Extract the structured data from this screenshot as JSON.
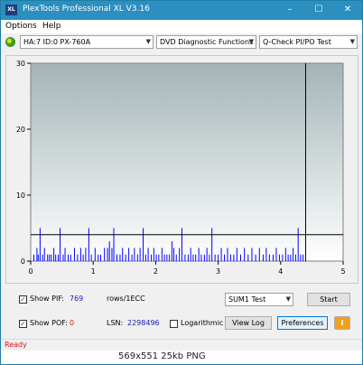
{
  "window": {
    "title": "PlexTools Professional XL V3.16",
    "icon_label": "XL",
    "minimize": "–",
    "maximize": "☐",
    "close": "✕"
  },
  "menu": {
    "options": "Options",
    "help": "Help"
  },
  "toolbar": {
    "device": "HA:7 ID:0  PX-760A",
    "function": "DVD Diagnostic Functions",
    "test": "Q-Check PI/PO Test"
  },
  "chart_data": {
    "type": "bar",
    "xlim": [
      0,
      5
    ],
    "ylim": [
      0,
      30
    ],
    "x_ticks": [
      0,
      1,
      2,
      3,
      4,
      5
    ],
    "y_ticks": [
      0,
      10,
      20,
      30
    ],
    "threshold": 4,
    "end_marker": 4.4,
    "bar_color": "#0000ff",
    "bars": [
      {
        "x": 0.05,
        "y": 1
      },
      {
        "x": 0.1,
        "y": 2
      },
      {
        "x": 0.12,
        "y": 1
      },
      {
        "x": 0.15,
        "y": 5
      },
      {
        "x": 0.19,
        "y": 1
      },
      {
        "x": 0.22,
        "y": 2
      },
      {
        "x": 0.27,
        "y": 1
      },
      {
        "x": 0.3,
        "y": 1
      },
      {
        "x": 0.33,
        "y": 1
      },
      {
        "x": 0.37,
        "y": 2
      },
      {
        "x": 0.4,
        "y": 1
      },
      {
        "x": 0.44,
        "y": 1
      },
      {
        "x": 0.47,
        "y": 5
      },
      {
        "x": 0.52,
        "y": 1
      },
      {
        "x": 0.55,
        "y": 2
      },
      {
        "x": 0.6,
        "y": 1
      },
      {
        "x": 0.64,
        "y": 1
      },
      {
        "x": 0.7,
        "y": 2
      },
      {
        "x": 0.75,
        "y": 1
      },
      {
        "x": 0.8,
        "y": 2
      },
      {
        "x": 0.84,
        "y": 1
      },
      {
        "x": 0.88,
        "y": 2
      },
      {
        "x": 0.93,
        "y": 5
      },
      {
        "x": 0.97,
        "y": 1
      },
      {
        "x": 1.03,
        "y": 2
      },
      {
        "x": 1.08,
        "y": 1
      },
      {
        "x": 1.12,
        "y": 1
      },
      {
        "x": 1.18,
        "y": 2
      },
      {
        "x": 1.23,
        "y": 2
      },
      {
        "x": 1.26,
        "y": 3
      },
      {
        "x": 1.3,
        "y": 2
      },
      {
        "x": 1.33,
        "y": 5
      },
      {
        "x": 1.38,
        "y": 1
      },
      {
        "x": 1.43,
        "y": 1
      },
      {
        "x": 1.47,
        "y": 2
      },
      {
        "x": 1.52,
        "y": 1
      },
      {
        "x": 1.57,
        "y": 2
      },
      {
        "x": 1.62,
        "y": 1
      },
      {
        "x": 1.66,
        "y": 2
      },
      {
        "x": 1.71,
        "y": 1
      },
      {
        "x": 1.75,
        "y": 2
      },
      {
        "x": 1.8,
        "y": 5
      },
      {
        "x": 1.84,
        "y": 1
      },
      {
        "x": 1.88,
        "y": 2
      },
      {
        "x": 1.93,
        "y": 1
      },
      {
        "x": 1.97,
        "y": 2
      },
      {
        "x": 2.01,
        "y": 1
      },
      {
        "x": 2.05,
        "y": 1
      },
      {
        "x": 2.1,
        "y": 2
      },
      {
        "x": 2.14,
        "y": 1
      },
      {
        "x": 2.18,
        "y": 1
      },
      {
        "x": 2.22,
        "y": 1
      },
      {
        "x": 2.26,
        "y": 3
      },
      {
        "x": 2.29,
        "y": 2
      },
      {
        "x": 2.33,
        "y": 1
      },
      {
        "x": 2.38,
        "y": 2
      },
      {
        "x": 2.42,
        "y": 5
      },
      {
        "x": 2.47,
        "y": 1
      },
      {
        "x": 2.52,
        "y": 1
      },
      {
        "x": 2.56,
        "y": 2
      },
      {
        "x": 2.6,
        "y": 1
      },
      {
        "x": 2.64,
        "y": 1
      },
      {
        "x": 2.69,
        "y": 2
      },
      {
        "x": 2.73,
        "y": 1
      },
      {
        "x": 2.78,
        "y": 1
      },
      {
        "x": 2.82,
        "y": 2
      },
      {
        "x": 2.86,
        "y": 1
      },
      {
        "x": 2.9,
        "y": 5
      },
      {
        "x": 2.95,
        "y": 1
      },
      {
        "x": 3.0,
        "y": 1
      },
      {
        "x": 3.05,
        "y": 2
      },
      {
        "x": 3.1,
        "y": 1
      },
      {
        "x": 3.15,
        "y": 2
      },
      {
        "x": 3.2,
        "y": 1
      },
      {
        "x": 3.25,
        "y": 1
      },
      {
        "x": 3.3,
        "y": 2
      },
      {
        "x": 3.36,
        "y": 1
      },
      {
        "x": 3.42,
        "y": 2
      },
      {
        "x": 3.48,
        "y": 1
      },
      {
        "x": 3.54,
        "y": 2
      },
      {
        "x": 3.6,
        "y": 1
      },
      {
        "x": 3.66,
        "y": 2
      },
      {
        "x": 3.72,
        "y": 1
      },
      {
        "x": 3.77,
        "y": 2
      },
      {
        "x": 3.82,
        "y": 1
      },
      {
        "x": 3.88,
        "y": 1
      },
      {
        "x": 3.93,
        "y": 2
      },
      {
        "x": 3.98,
        "y": 1
      },
      {
        "x": 4.03,
        "y": 1
      },
      {
        "x": 4.08,
        "y": 2
      },
      {
        "x": 4.12,
        "y": 1
      },
      {
        "x": 4.16,
        "y": 1
      },
      {
        "x": 4.2,
        "y": 2
      },
      {
        "x": 4.24,
        "y": 1
      },
      {
        "x": 4.28,
        "y": 5
      },
      {
        "x": 4.32,
        "y": 1
      },
      {
        "x": 4.36,
        "y": 1
      }
    ]
  },
  "bottom": {
    "show_pif_label": "Show PIF:",
    "pif_value": "769",
    "pif_units": "rows/1ECC",
    "show_pof_label": "Show POF:",
    "pof_value": "0",
    "lsn_label": "LSN:",
    "lsn_value": "2298496",
    "log_label": "Logarithmic",
    "sum_select": "SUM1 Test",
    "start_label": "Start",
    "view_log_label": "View Log",
    "preferences_label": "Preferences",
    "check_mark": "✓",
    "info_icon": "i"
  },
  "status": "Ready",
  "caption": "569x551 25kb PNG"
}
